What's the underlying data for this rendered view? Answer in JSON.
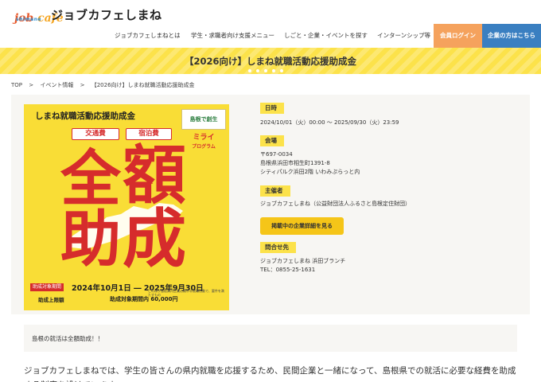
{
  "header": {
    "logo_jobcafe_j": "job",
    "logo_jobcafe_c": "cafe",
    "logo_sub": "shimane",
    "logo_main": "ジョブカフェしまね"
  },
  "nav": {
    "items": [
      "ジョブカフェしまねとは",
      "学生・求職者向け支援メニュー",
      "しごと・企業・イベントを探す",
      "インターンシップ等"
    ],
    "login_label": "会員ログイン",
    "company_label": "企業の方はこちら"
  },
  "banner": {
    "title": "【2026向け】しまね就職活動応援助成金"
  },
  "breadcrumb": {
    "items": [
      "TOP",
      ">",
      "イベント情報",
      ">",
      "【2026向け】しまね就職活動応援助成金"
    ]
  },
  "poster": {
    "title": "しまね就職活動応援助成金",
    "tag1": "交通費",
    "tag2": "宿泊費",
    "logo1": "島根で創生",
    "logo2_line1": "ミライ",
    "logo2_line2": "プログラム",
    "chars": [
      "全",
      "額",
      "助",
      "成"
    ],
    "period_label": "助成対象期間",
    "period": "2024年10月1日 ― 2025年9月30日",
    "limit_label": "助成上限額",
    "limit": "助成対象期間内 60,000円",
    "note": "このほか島根県内企業に関わる就職活動で、要件を満たすもの"
  },
  "info": {
    "date_label": "日時",
    "date_value": "2024/10/01（火）00:00 ～ 2025/09/30（火）23:59",
    "venue_label": "会場",
    "venue_zip": "〒697-0034",
    "venue_addr1": "島根県浜田市相生町1391-8",
    "venue_addr2": "シティパルク浜田2階 いわみぷらっと内",
    "host_label": "主催者",
    "host_value": "ジョブカフェしまね（公益財団法人ふるさと島根定住財団）",
    "cta_label": "掲載中の企業詳細を見る",
    "contact_label": "問合せ先",
    "contact_name": "ジョブカフェしまね 浜田ブランチ",
    "contact_tel": "TEL：0855-25-1631"
  },
  "summary": {
    "text": "島根の就活は全額助成！！"
  },
  "body": {
    "text": "ジョブカフェしまねでは、学生の皆さんの県内就職を応援するため、民間企業と一緒になって、島根県での就活に必要な経費を助成する制度を設けています。"
  },
  "colors": {
    "banner": "#fce24a",
    "login": "#f5a25d",
    "company": "#3a7fc1",
    "poster_red": "#d62c2c",
    "poster_yellow": "#f9dd36"
  }
}
